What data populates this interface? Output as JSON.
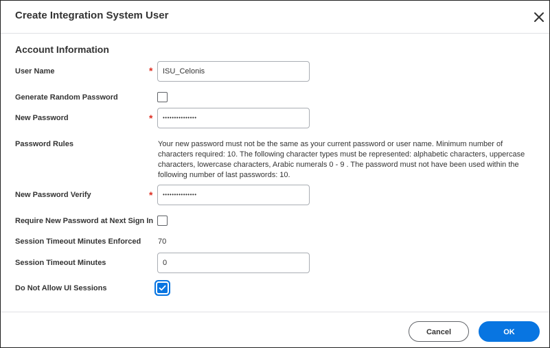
{
  "dialog": {
    "title": "Create Integration System User",
    "close_icon": "close-icon"
  },
  "section": {
    "title": "Account Information"
  },
  "fields": {
    "user_name": {
      "label": "User Name",
      "required_mark": "*",
      "value": "ISU_Celonis"
    },
    "generate_random_password": {
      "label": "Generate Random Password",
      "checked": false
    },
    "new_password": {
      "label": "New Password",
      "required_mark": "*",
      "value": "•••••••••••••••"
    },
    "password_rules": {
      "label": "Password Rules",
      "text": "Your new password must not be the same as your current password or user name. Minimum number of characters required: 10. The following character types must be represented: alphabetic characters, uppercase characters, lowercase characters, Arabic numerals 0 - 9 .  The password must not have been used within the following number of last passwords: 10."
    },
    "new_password_verify": {
      "label": "New Password Verify",
      "required_mark": "*",
      "value": "•••••••••••••••"
    },
    "require_new_password": {
      "label": "Require New Password at Next Sign In",
      "checked": false
    },
    "session_timeout_enforced": {
      "label": "Session Timeout Minutes Enforced",
      "value": "70"
    },
    "session_timeout_minutes": {
      "label": "Session Timeout Minutes",
      "value": "0"
    },
    "do_not_allow_ui_sessions": {
      "label": "Do Not Allow UI Sessions",
      "checked": true
    }
  },
  "footer": {
    "cancel_label": "Cancel",
    "ok_label": "OK"
  },
  "colors": {
    "accent": "#0875e1",
    "required": "#de2e21",
    "text": "#333333",
    "divider": "#dfe1e4"
  }
}
